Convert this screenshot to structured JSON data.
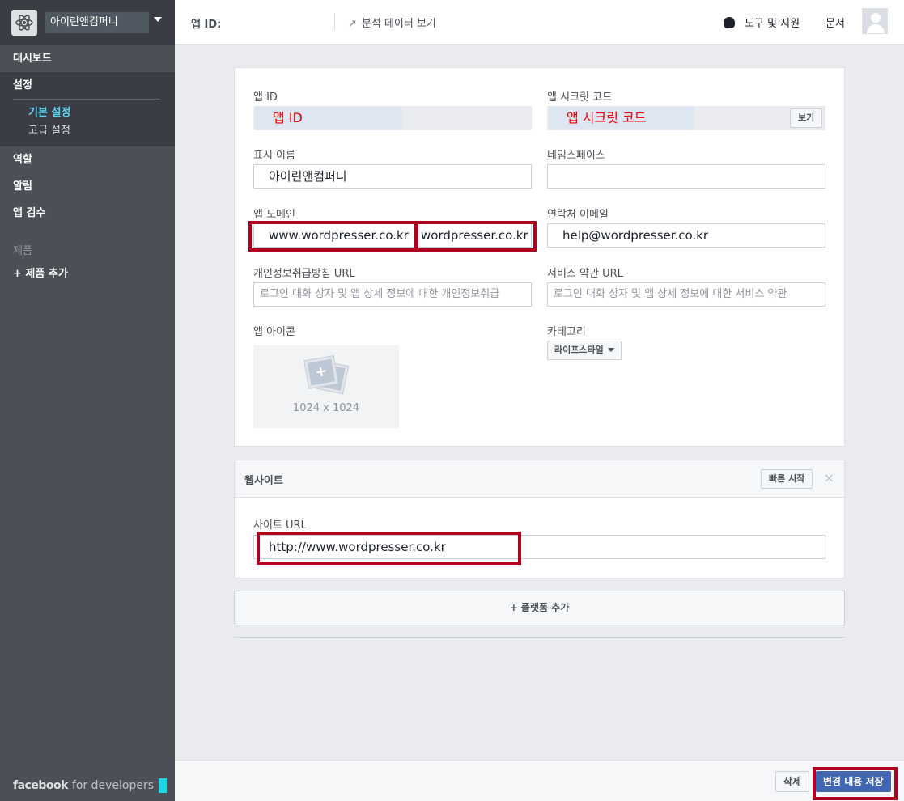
{
  "sidebar": {
    "app_name": "아이린앤컴퍼니",
    "items": {
      "dashboard": "대시보드",
      "settings": "설정",
      "basic_settings": "기본 설정",
      "advanced_settings": "고급 설정",
      "roles": "역할",
      "alerts": "알림",
      "app_review": "앱 검수",
      "products_heading": "제품",
      "add_product": "+ 제품 추가"
    },
    "brand": {
      "strong": "facebook",
      "light": "for developers"
    }
  },
  "topbar": {
    "app_id_label": "앱 ID:",
    "analytics": "분석 데이터 보기",
    "analytics_icon": "trend-arrow-icon",
    "tools": "도구 및 지원",
    "docs": "문서"
  },
  "basic": {
    "app_id_label": "앱 ID",
    "app_id_value": "앱 ID",
    "app_secret_label": "앱 시크릿 코드",
    "app_secret_value": "앱 시크릿 코드",
    "show_button": "보기",
    "display_name_label": "표시 이름",
    "display_name_value": "아이린앤컴퍼니",
    "namespace_label": "네임스페이스",
    "namespace_value": "",
    "app_domain_label": "앱 도메인",
    "app_domains": [
      "www.wordpresser.co.kr",
      "wordpresser.co.kr"
    ],
    "contact_email_label": "연락처 이메일",
    "contact_email_value": "help@wordpresser.co.kr",
    "privacy_url_label": "개인정보취급방침 URL",
    "privacy_url_placeholder": "로그인 대화 상자 및 앱 상세 정보에 대한 개인정보취급",
    "tos_url_label": "서비스 약관 URL",
    "tos_url_placeholder": "로그인 대화 상자 및 앱 상세 정보에 대한 서비스 약관",
    "app_icon_label": "앱 아이콘",
    "app_icon_size": "1024 x 1024",
    "category_label": "카테고리",
    "category_value": "라이프스타일"
  },
  "website": {
    "title": "웹사이트",
    "quick_start": "빠른 시작",
    "close": "×",
    "site_url_label": "사이트 URL",
    "site_url_value": "http://www.wordpresser.co.kr"
  },
  "add_platform": "+ 플랫폼 추가",
  "footer": {
    "delete": "삭제",
    "save": "변경 내용 저장"
  },
  "colors": {
    "sidebar_bg": "#4b4f56",
    "active_sub": "#5bd3f0",
    "primary_button": "#4267b2",
    "highlight_box": "#b0001e"
  }
}
